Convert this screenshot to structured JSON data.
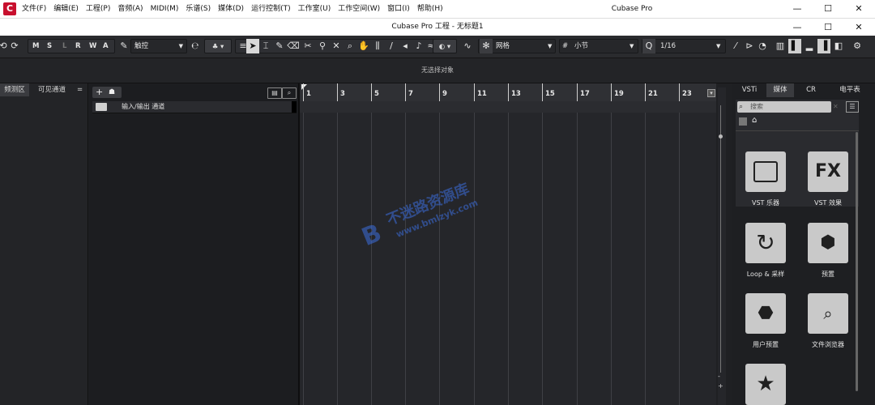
{
  "app": {
    "logo_letter": "C",
    "window_title": "Cubase Pro",
    "project_title": "Cubase Pro 工程 - 无标题1",
    "menu": [
      "文件(F)",
      "编辑(E)",
      "工程(P)",
      "音频(A)",
      "MIDI(M)",
      "乐谱(S)",
      "媒体(D)",
      "运行控制(T)",
      "工作室(U)",
      "工作空间(W)",
      "窗口(I)",
      "帮助(H)"
    ],
    "win_controls": {
      "minimize": "—",
      "maximize": "☐",
      "close": "✕"
    }
  },
  "toolbar": {
    "mode_buttons": [
      "M",
      "S",
      "L",
      "R",
      "W",
      "A"
    ],
    "automation_mode": "触控",
    "grid_type": "网格",
    "quantize_label": "小节",
    "quantize_value": "1/16"
  },
  "infoline": {
    "text": "无选择对象"
  },
  "left_zone": {
    "tabs": [
      "频测区",
      "可见通道"
    ]
  },
  "tracklist": {
    "tracks": [
      {
        "name": "输入/输出 通道"
      }
    ]
  },
  "ruler": {
    "bars": [
      "1",
      "3",
      "5",
      "7",
      "9",
      "11",
      "13",
      "15",
      "17",
      "19",
      "21",
      "23"
    ]
  },
  "right_zone": {
    "tabs": [
      "VSTi",
      "媒体",
      "CR",
      "电平表"
    ],
    "active_tab": "媒体",
    "search_placeholder": "搜索",
    "tiles": [
      {
        "icon": "piano-keys-icon",
        "label": "VST 乐器"
      },
      {
        "icon": "fx-icon",
        "label": "VST 效果",
        "glyph": "FX"
      },
      {
        "icon": "loop-icon",
        "label": "Loop & 采样"
      },
      {
        "icon": "presets-icon",
        "label": "预置"
      },
      {
        "icon": "user-presets-icon",
        "label": "用户预置"
      },
      {
        "icon": "file-browser-icon",
        "label": "文件浏览器"
      },
      {
        "icon": "favorites-star-icon",
        "label": ""
      }
    ]
  },
  "watermark": {
    "cn": "不迷路资源库",
    "url": "www.bmlzyk.com"
  }
}
